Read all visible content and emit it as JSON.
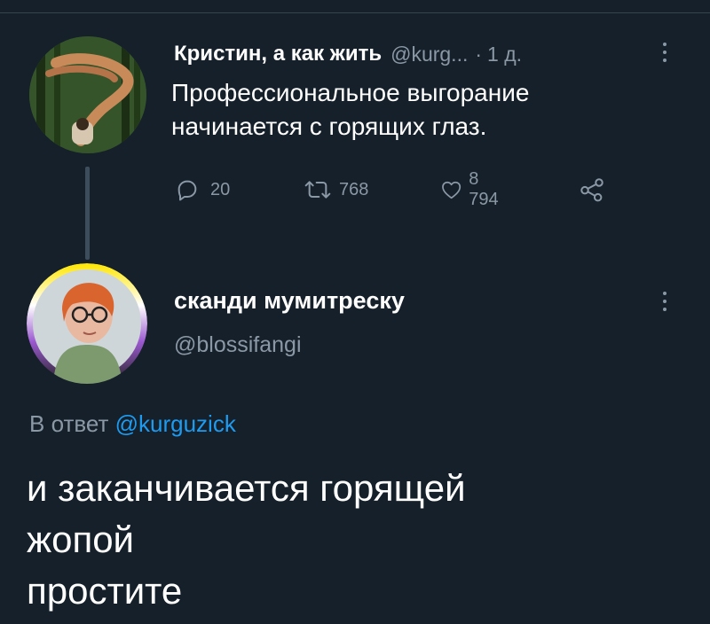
{
  "parent_tweet": {
    "author_name": "Кристин, а как жить",
    "author_handle": "@kurg...",
    "separator": "·",
    "time": "1 д.",
    "text": "Профессиональное выгорание начинается с горящих глаз.",
    "replies": "20",
    "retweets": "768",
    "likes": "8 794"
  },
  "reply_tweet": {
    "author_name": "сканди мумитреску",
    "author_handle": "@blossifangi",
    "reply_prefix": "В ответ",
    "reply_mention": "@kurguzick",
    "text_lines": [
      "и заканчивается горящей",
      "жопой",
      "простите"
    ]
  },
  "icons": {
    "reply": "comment-icon",
    "retweet": "retweet-icon",
    "like": "heart-icon",
    "share": "share-icon",
    "more": "more-vertical-icon"
  },
  "colors": {
    "background": "#15202b",
    "secondary_text": "#8b98a5",
    "link": "#1d9bf0",
    "primary_text": "#ffffff"
  }
}
